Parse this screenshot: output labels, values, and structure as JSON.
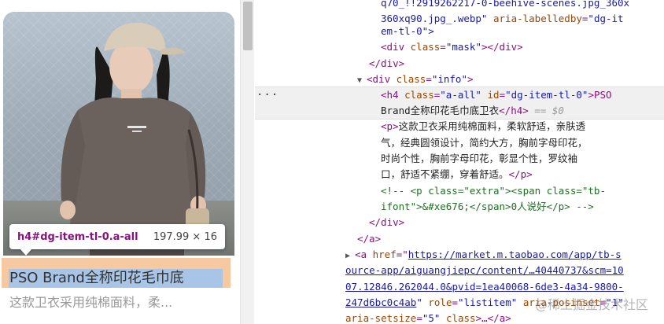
{
  "preview": {
    "tooltip_selector": "h4#dg-item-tl-0.a-all",
    "tooltip_dims": "197.99 × 16",
    "product_title": "PSO Brand全称印花毛巾底",
    "product_desc": "这款卫衣采用纯棉面料，柔..."
  },
  "devtools": {
    "l0_text": "q70_!!2919262217-0-beehive-scenes.jpg_360x",
    "l1_text": "360xq90.jpg_.webp\"",
    "l1_attr": "aria-labelledby",
    "l1_val": "\"dg-it",
    "l2_text": "em-tl-0\">",
    "l3_tag": "<div",
    "l3_attr": "class",
    "l3_val": "\"mask\"",
    "l3_close": "></div>",
    "l4_close": "</div>",
    "l5_tag": "<div",
    "l5_attr": "class",
    "l5_val": "\"info\"",
    "l5_end": ">",
    "l6_tag": "<h4",
    "l6_attr1": "class",
    "l6_val1": "\"a-all\"",
    "l6_attr2": "id",
    "l6_val2": "\"dg-item-tl-0\"",
    "l6_text": ">PSO",
    "l7_text": "Brand全称印花毛巾底卫衣",
    "l7_close": "</h4>",
    "l7_dollar": " == $0",
    "l8_tag": "<p>",
    "l8_text": "这款卫衣采用纯棉面料，柔软舒适，亲肤透",
    "l9_text": "气，经典圆领设计，简约大方，胸前字母印花，",
    "l10_text": "时尚个性，胸前字母印花，彰显个性，罗纹袖",
    "l11_text": "口，舒适不紧绷，穿着舒适。",
    "l11_close": "</p>",
    "l12_text": "<!-- <p class=\"extra\"><span class=\"tb-",
    "l13_text": "ifont\">&#xe676;</span>0人说好</p> -->",
    "l14_close": "</div>",
    "l15_close": "</a>",
    "l16_tag": "<a",
    "l16_attr": "href",
    "l16_eq": "=\"",
    "l16_link": "https://market.m.taobao.com/app/tb-s",
    "l17_link": "ource-app/aiguangjiepc/content/…40440737&scm=10",
    "l18_link": "07.12846.262044.0&pvid=1ea40068-6de3-4a34-9800-",
    "l19_link": "247d6bc0c4ab",
    "l19_rest_quote": "\"",
    "l19_attr1": "role",
    "l19_val1": "\"listitem\"",
    "l19_attr2": "aria-posinset",
    "l19_val2": "\"1\"",
    "l20_attr": "aria-setsize",
    "l20_val": "\"5\"",
    "l20_attr2": "class",
    "l20_end": ">…</a>",
    "watermark": "@稀土掘金技术社区"
  }
}
